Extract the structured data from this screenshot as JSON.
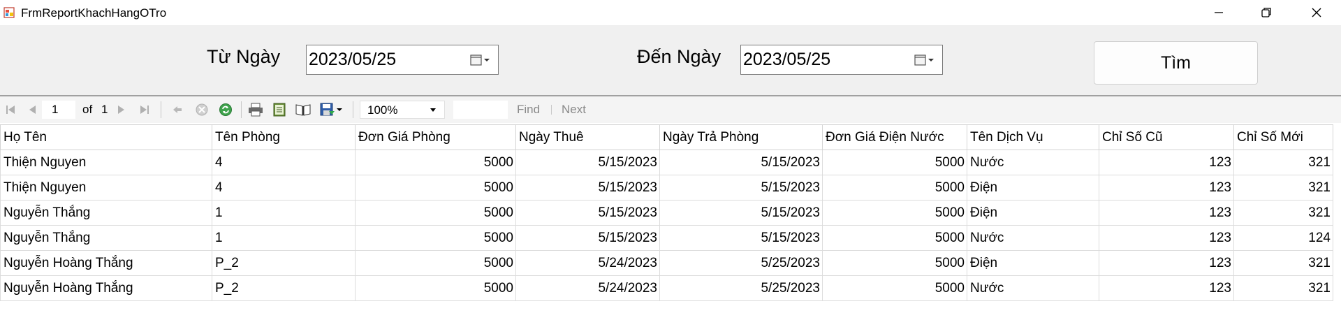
{
  "window": {
    "title": "FrmReportKhachHangOTro"
  },
  "filters": {
    "from_label": "Từ Ngày",
    "from_value": "2023/05/25",
    "to_label": "Đến Ngày",
    "to_value": "2023/05/25",
    "search_button": "Tìm"
  },
  "toolbar": {
    "page_current": "1",
    "page_of": "of",
    "page_total": "1",
    "zoom": "100%",
    "find_label": "Find",
    "next_label": "Next"
  },
  "table": {
    "headers": [
      "Họ Tên",
      "Tên Phòng",
      "Đơn Giá Phòng",
      "Ngày Thuê",
      "Ngày Trả Phòng",
      "Đơn Giá Điện Nước",
      "Tên Dịch Vụ",
      "Chỉ Số Cũ",
      "Chỉ Số Mới"
    ],
    "rows": [
      [
        "Thiện Nguyen",
        "4",
        "5000",
        "5/15/2023",
        "5/15/2023",
        "5000",
        "Nước",
        "123",
        "321"
      ],
      [
        "Thiện Nguyen",
        "4",
        "5000",
        "5/15/2023",
        "5/15/2023",
        "5000",
        "Điện",
        "123",
        "321"
      ],
      [
        "Nguyễn Thắng",
        "1",
        "5000",
        "5/15/2023",
        "5/15/2023",
        "5000",
        "Điện",
        "123",
        "321"
      ],
      [
        "Nguyễn Thắng",
        "1",
        "5000",
        "5/15/2023",
        "5/15/2023",
        "5000",
        "Nước",
        "123",
        "124"
      ],
      [
        "Nguyễn Hoàng Thắng",
        "P_2",
        "5000",
        "5/24/2023",
        "5/25/2023",
        "5000",
        "Điện",
        "123",
        "321"
      ],
      [
        "Nguyễn Hoàng Thắng",
        "P_2",
        "5000",
        "5/24/2023",
        "5/25/2023",
        "5000",
        "Nước",
        "123",
        "321"
      ]
    ]
  },
  "icons": {
    "app": "report-app-icon",
    "minimize": "minimize-icon",
    "restore": "restore-icon",
    "close": "close-icon"
  }
}
